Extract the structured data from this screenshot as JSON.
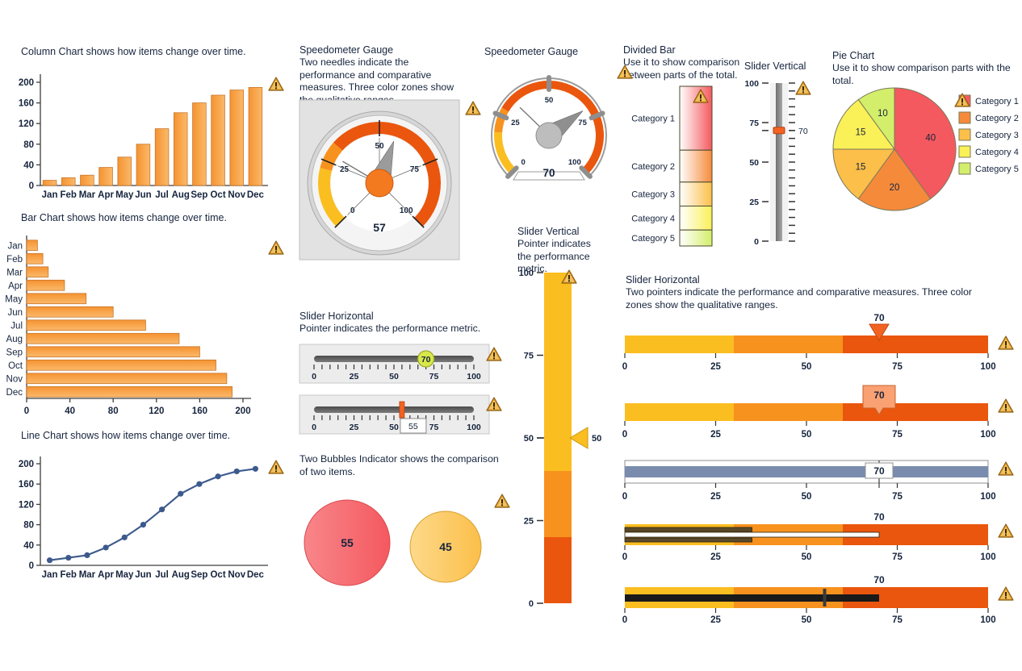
{
  "colors": {
    "bar_fill_light": "#FBB96A",
    "bar_fill_dark": "#F59331",
    "bar_stroke": "#C8762A",
    "line": "#3C5A8C",
    "cat1": "#F4595F",
    "cat2": "#F68A3B",
    "cat3": "#FBBF4A",
    "cat4": "#FAF057",
    "cat5": "#D3EE6B",
    "zone_low": "#FBBE20",
    "zone_mid": "#F7921E",
    "zone_high": "#EA560D",
    "bullet_blue": "#7A8CAE",
    "warn_fill": "#E3A12C"
  },
  "panels": {
    "column_chart": {
      "title": "Column Chart shows how items change over time."
    },
    "bar_chart": {
      "title": "Bar Chart shows how items change over time."
    },
    "line_chart": {
      "title": "Line Chart shows how items change over time."
    },
    "speedometer_1": {
      "title": "Speedometer Gauge",
      "description": "Two needles indicate the performance and comparative measures. Three color zones show the qualitative ranges."
    },
    "speedometer_2": {
      "title": "Speedometer Gauge"
    },
    "divided_bar": {
      "title": "Divided Bar",
      "description": "Use it to show comparison between parts of the total."
    },
    "slider_vertical_1": {
      "title": "Slider Vertical"
    },
    "pie_chart": {
      "title": "Pie Chart",
      "description": "Use it to show comparison parts with the total."
    },
    "slider_horizontal_1": {
      "title": "Slider Horizontal",
      "description": "Pointer indicates the performance metric."
    },
    "bubbles": {
      "description": "Two Bubbles Indicator shows the comparison of two items."
    },
    "slider_vertical_2": {
      "title": "Slider Vertical",
      "description": "Pointer indicates the performance metric."
    },
    "slider_horizontal_2": {
      "title": "Slider Horizontal",
      "description": "Two pointers indicate the performance and comparative measures. Three color zones show the qualitative ranges."
    }
  },
  "chart_data": [
    {
      "type": "bar",
      "title": "Column Chart shows how items change over time.",
      "orientation": "vertical",
      "categories": [
        "Jan",
        "Feb",
        "Mar",
        "Apr",
        "May",
        "Jun",
        "Jul",
        "Aug",
        "Sep",
        "Oct",
        "Nov",
        "Dec"
      ],
      "values": [
        10,
        15,
        20,
        35,
        55,
        80,
        110,
        141,
        160,
        175,
        185,
        190
      ],
      "ylim": [
        0,
        200
      ],
      "yticks": [
        0,
        40,
        80,
        120,
        160,
        200
      ],
      "xlabel": "",
      "ylabel": "",
      "grid": false
    },
    {
      "type": "bar",
      "title": "Bar Chart shows how items change over time.",
      "orientation": "horizontal",
      "categories": [
        "Jan",
        "Feb",
        "Mar",
        "Apr",
        "May",
        "Jun",
        "Jul",
        "Aug",
        "Sep",
        "Oct",
        "Nov",
        "Dec"
      ],
      "values": [
        10,
        15,
        20,
        35,
        55,
        80,
        110,
        141,
        160,
        175,
        185,
        190
      ],
      "xlim": [
        0,
        200
      ],
      "xticks": [
        0,
        40,
        80,
        120,
        160,
        200
      ],
      "grid": false
    },
    {
      "type": "line",
      "title": "Line Chart shows how items change over time.",
      "categories": [
        "Jan",
        "Feb",
        "Mar",
        "Apr",
        "May",
        "Jun",
        "Jul",
        "Aug",
        "Sep",
        "Oct",
        "Nov",
        "Dec"
      ],
      "values": [
        10,
        15,
        20,
        35,
        55,
        80,
        110,
        141,
        160,
        175,
        185,
        190
      ],
      "ylim": [
        0,
        200
      ],
      "yticks": [
        0,
        40,
        80,
        120,
        160,
        200
      ],
      "markers": true,
      "grid": false
    },
    {
      "type": "pie",
      "title": "Pie Chart",
      "labels": [
        "Category 1",
        "Category 2",
        "Category 3",
        "Category 4",
        "Category 5"
      ],
      "values": [
        40,
        20,
        15,
        15,
        10
      ],
      "legend_position": "right"
    },
    {
      "type": "bar",
      "title": "Divided Bar",
      "orientation": "stacked-vertical",
      "labels": [
        "Category 1",
        "Category 2",
        "Category 3",
        "Category 4",
        "Category 5"
      ],
      "values": [
        40,
        20,
        15,
        15,
        10
      ]
    }
  ],
  "gauges": {
    "speedometer_1": {
      "value": 57,
      "value_label": "57",
      "min": 0,
      "max": 100,
      "ticks": [
        "0",
        "25",
        "50",
        "75",
        "100"
      ],
      "needle_primary": 57,
      "needle_secondary": 28,
      "zones": [
        [
          0,
          22
        ],
        [
          22,
          32
        ],
        [
          32,
          100
        ]
      ]
    },
    "speedometer_2": {
      "value": 70,
      "value_label": "70",
      "min": 0,
      "max": 100,
      "ticks": [
        "0",
        "25",
        "50",
        "75",
        "100"
      ],
      "needle_primary": 70,
      "needle_secondary": 33,
      "zones": [
        [
          0,
          18
        ],
        [
          18,
          28
        ],
        [
          28,
          100
        ]
      ]
    }
  },
  "sliders": {
    "vertical_tick_slider": {
      "value": 70,
      "value_label": "70",
      "min": 0,
      "max": 100,
      "labels": [
        "100",
        "75",
        "50",
        "25",
        "0"
      ]
    },
    "vertical_zone_slider": {
      "value": 50,
      "value_label": "50",
      "min": 0,
      "max": 100,
      "labels": [
        "100",
        "75",
        "50",
        "25",
        "0"
      ],
      "zones": [
        [
          0,
          20
        ],
        [
          20,
          40
        ],
        [
          40,
          100
        ]
      ]
    },
    "horizontal_knob": {
      "value": 70,
      "value_label": "70",
      "min": 0,
      "max": 100,
      "labels": [
        "0",
        "25",
        "50",
        "75",
        "100"
      ]
    },
    "horizontal_marker": {
      "value": 55,
      "value_label": "55",
      "min": 0,
      "max": 100,
      "labels": [
        "0",
        "25",
        "50",
        "75",
        "100"
      ]
    },
    "zone_triangle": {
      "value": 70,
      "value_label": "70",
      "min": 0,
      "max": 100,
      "labels": [
        "0",
        "25",
        "50",
        "75",
        "100"
      ],
      "zones": [
        [
          0,
          30
        ],
        [
          30,
          60
        ],
        [
          60,
          100
        ]
      ]
    },
    "zone_callout": {
      "value": 70,
      "value_label": "70",
      "min": 0,
      "max": 100,
      "labels": [
        "0",
        "25",
        "50",
        "75",
        "100"
      ],
      "zones": [
        [
          0,
          30
        ],
        [
          30,
          60
        ],
        [
          60,
          100
        ]
      ]
    },
    "bullet_blue": {
      "value": 70,
      "value_label": "70",
      "min": 0,
      "max": 100,
      "labels": [
        "0",
        "25",
        "50",
        "75",
        "100"
      ]
    },
    "bullet_striped": {
      "value": 70,
      "value_label": "70",
      "comparative": 35,
      "min": 0,
      "max": 100,
      "labels": [
        "0",
        "25",
        "50",
        "75",
        "100"
      ],
      "zones": [
        [
          0,
          30
        ],
        [
          30,
          60
        ],
        [
          60,
          100
        ]
      ]
    },
    "bullet_black": {
      "value": 70,
      "value_label": "70",
      "comparative": 55,
      "min": 0,
      "max": 100,
      "labels": [
        "0",
        "25",
        "50",
        "75",
        "100"
      ],
      "zones": [
        [
          0,
          30
        ],
        [
          30,
          60
        ],
        [
          60,
          100
        ]
      ]
    }
  },
  "bubbles": {
    "left": {
      "value": 55,
      "value_label": "55"
    },
    "right": {
      "value": 45,
      "value_label": "45"
    }
  },
  "icons": {
    "warning": "warning-triangle-icon"
  }
}
